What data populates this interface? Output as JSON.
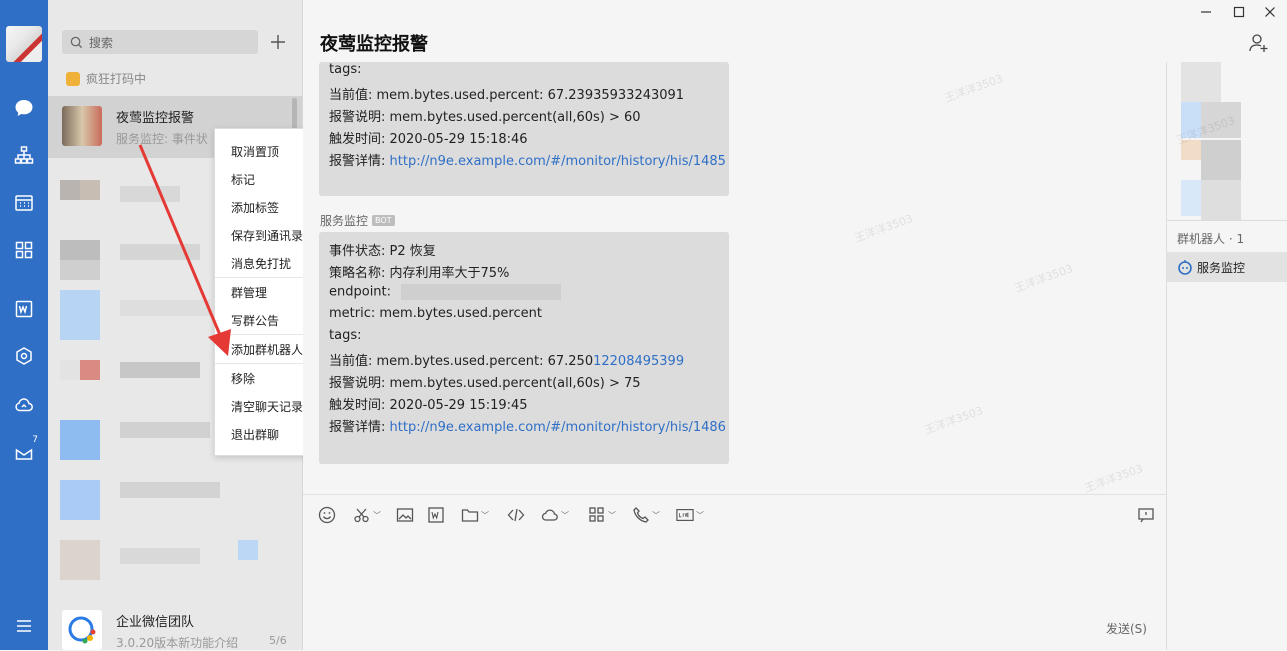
{
  "window": {
    "min_label": "—",
    "max_label": "☐",
    "close_label": "✕"
  },
  "search": {
    "placeholder": "搜索"
  },
  "status_text": "疯狂打码中",
  "active_conversation": {
    "title": "夜莺监控报警",
    "preview": "服务监控: 事件状"
  },
  "bottom_conversation": {
    "title": "企业微信团队",
    "preview": "3.0.20版本新功能介绍",
    "count": "5/6"
  },
  "context_menu": {
    "items": [
      "取消置顶",
      "标记",
      "添加标签",
      "保存到通讯录",
      "消息免打扰",
      "群管理",
      "写群公告",
      "添加群机器人",
      "移除",
      "清空聊天记录",
      "退出群聊"
    ]
  },
  "chat": {
    "title": "夜莺监控报警",
    "message1": {
      "tags": "tags:",
      "current": "当前值: mem.bytes.used.percent: 67.23935933243091",
      "desc": "报警说明:  mem.bytes.used.percent(all,60s) > 60",
      "time": "触发时间:  2020-05-29 15:18:46",
      "detail_label": "报警详情:",
      "detail_link": "http://n9e.example.com/#/monitor/history/his/1485"
    },
    "sender": "服务监控",
    "bot_badge": "BOT",
    "message2": {
      "status": "事件状态:  P2 恢复",
      "policy": "策略名称:  内存利用率大于75%",
      "endpoint": "endpoint:",
      "metric": "metric:  mem.bytes.used.percent",
      "tags": "tags:",
      "current_prefix": "当前值: mem.bytes.used.percent: 67.250",
      "current_suffix": "12208495399",
      "desc": "报警说明:  mem.bytes.used.percent(all,60s) > 75",
      "time": "触发时间:  2020-05-29 15:19:45",
      "detail_label": "报警详情:",
      "detail_link": "http://n9e.example.com/#/monitor/history/his/1486"
    },
    "send_label": "发送(S)"
  },
  "right_panel": {
    "robot_label": "群机器人 · 1",
    "robot_name": "服务监控"
  },
  "nav_badge": "7",
  "watermark": "王洋洋3503",
  "colors": {
    "sidebar": "#2f6fc6",
    "link": "#2f6fc6",
    "arrow": "#e53935"
  }
}
